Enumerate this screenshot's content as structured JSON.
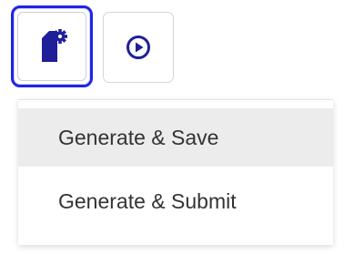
{
  "toolbar": {
    "generate_button": {
      "icon": "document-gear-icon",
      "color": "#1f1f99",
      "focus_ring": "#1f24e6"
    },
    "run_button": {
      "icon": "play-circle-icon",
      "color": "#1f1f99"
    }
  },
  "menu": {
    "items": [
      {
        "label": "Generate & Save"
      },
      {
        "label": "Generate & Submit"
      }
    ]
  }
}
